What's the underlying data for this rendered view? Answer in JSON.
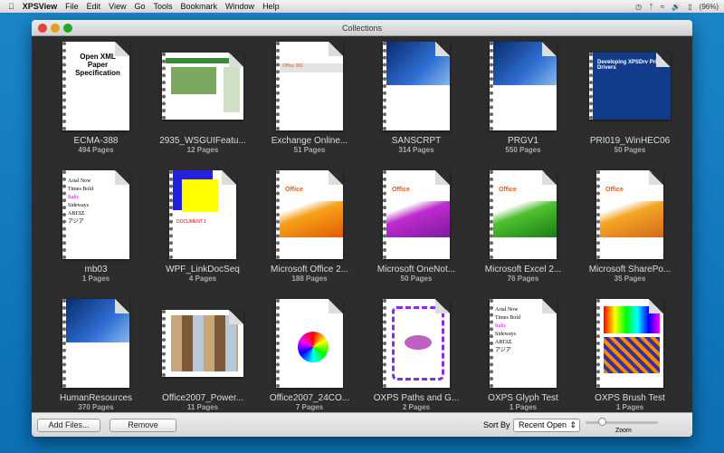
{
  "menubar": {
    "app": "XPSView",
    "items": [
      "File",
      "Edit",
      "View",
      "Go",
      "Tools",
      "Bookmark",
      "Window",
      "Help"
    ],
    "battery": "(96%)"
  },
  "window": {
    "title": "Collections"
  },
  "items": [
    {
      "name": "ECMA-388",
      "pages": "494 Pages",
      "style": "ecma",
      "thumb_text": "Open XML Paper Specification"
    },
    {
      "name": "2935_WSGUIFeatu...",
      "pages": "12 Pages",
      "style": "land-green"
    },
    {
      "name": "Exchange Online...",
      "pages": "51 Pages",
      "style": "o365",
      "thumb_text": "Office 365"
    },
    {
      "name": "SANSCRPT",
      "pages": "314 Pages",
      "style": "dyn"
    },
    {
      "name": "PRGV1",
      "pages": "550 Pages",
      "style": "dyn"
    },
    {
      "name": "PRI019_WinHEC06",
      "pages": "50 Pages",
      "style": "land-blue",
      "thumb_text": "Developing XPSDrv Print Drivers"
    },
    {
      "name": "mb03",
      "pages": "1 Pages",
      "style": "fonts"
    },
    {
      "name": "WPF_LinkDocSeq",
      "pages": "4 Pages",
      "style": "wpf"
    },
    {
      "name": "Microsoft Office 2...",
      "pages": "188 Pages",
      "style": "office-orange",
      "thumb_text": "Office"
    },
    {
      "name": "Microsoft OneNot...",
      "pages": "50 Pages",
      "style": "office-purple",
      "thumb_text": "Office"
    },
    {
      "name": "Microsoft Excel 2...",
      "pages": "76 Pages",
      "style": "office-green",
      "thumb_text": "Office"
    },
    {
      "name": "Microsoft SharePo...",
      "pages": "35 Pages",
      "style": "office-orange2",
      "thumb_text": "Office"
    },
    {
      "name": "HumanResources",
      "pages": "370 Pages",
      "style": "dyn"
    },
    {
      "name": "Office2007_Power...",
      "pages": "11 Pages",
      "style": "land-tiles"
    },
    {
      "name": "Office2007_24CO...",
      "pages": "7 Pages",
      "style": "hex"
    },
    {
      "name": "OXPS Paths and G...",
      "pages": "2 Pages",
      "style": "paths"
    },
    {
      "name": "OXPS Glyph Test",
      "pages": "1 Pages",
      "style": "fonts"
    },
    {
      "name": "OXPS Brush Test",
      "pages": "1 Pages",
      "style": "brush"
    }
  ],
  "bottombar": {
    "add_files": "Add Files...",
    "remove": "Remove",
    "sort_by": "Sort By",
    "sort_value": "Recent Open",
    "zoom_label": "Zoom"
  },
  "zoom_level": 0.2
}
